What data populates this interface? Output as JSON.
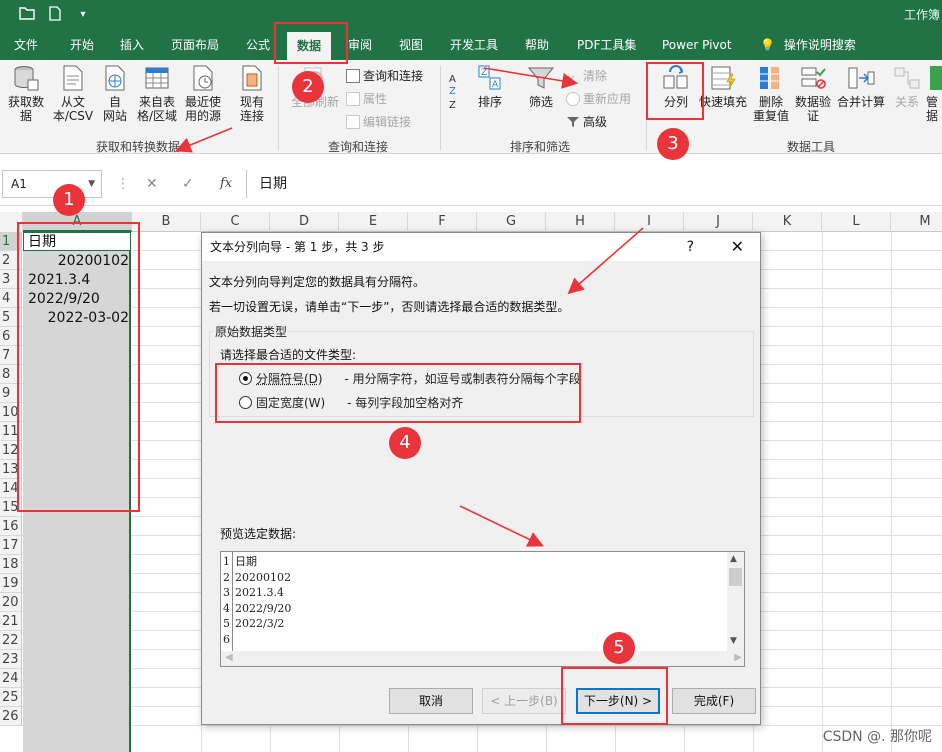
{
  "window": {
    "title_partial": "工作簿",
    "quick_access": [
      "folder-icon",
      "new-file-icon",
      "customize-icon"
    ]
  },
  "tabs": [
    "文件",
    "开始",
    "插入",
    "页面布局",
    "公式",
    "数据",
    "审阅",
    "视图",
    "开发工具",
    "帮助",
    "PDF工具集",
    "Power Pivot",
    "操作说明搜索"
  ],
  "active_tab": "数据",
  "ribbon": {
    "get_transform": {
      "buttons": [
        {
          "label": "获取数\n据",
          "icon": "database-icon"
        },
        {
          "label": "从文\n本/CSV",
          "icon": "text-file-icon"
        },
        {
          "label": "自\n网站",
          "icon": "web-icon"
        },
        {
          "label": "来自表\n格/区域",
          "icon": "table-icon"
        },
        {
          "label": "最近使\n用的源",
          "icon": "recent-icon"
        },
        {
          "label": "现有\n连接",
          "icon": "connection-icon"
        }
      ],
      "group_label": "获取和转换数据"
    },
    "queries": {
      "refresh_label": "全部刷新",
      "items": [
        "查询和连接",
        "属性",
        "编辑链接"
      ],
      "group_label": "查询和连接"
    },
    "sort_filter": {
      "sort_label": "排序",
      "filter_label": "筛选",
      "items": [
        "清除",
        "重新应用",
        "高级"
      ],
      "group_label": "排序和筛选"
    },
    "data_tools": {
      "buttons": [
        "分列",
        "快速填充",
        "删除\n重复值",
        "数据验\n证",
        "合并计算",
        "关系",
        "管\n据"
      ],
      "group_label": "数据工具"
    }
  },
  "formula_bar": {
    "name_box": "A1",
    "cancel_symbol": "✕",
    "enter_symbol": "✓",
    "fx_symbol": "fx",
    "value": "日期"
  },
  "grid": {
    "columns": [
      "A",
      "B",
      "C",
      "D",
      "E",
      "F",
      "G",
      "H",
      "I",
      "J",
      "K",
      "L",
      "M"
    ],
    "rows": [
      "1",
      "2",
      "3",
      "4",
      "5",
      "6",
      "7",
      "8",
      "9",
      "10",
      "11",
      "12",
      "13",
      "14",
      "15",
      "16",
      "17",
      "18",
      "19",
      "20",
      "21",
      "22",
      "23",
      "24",
      "25",
      "26"
    ],
    "cells": [
      {
        "value": "日期",
        "align": "left"
      },
      {
        "value": "20200102",
        "align": "right"
      },
      {
        "value": "2021.3.4",
        "align": "left"
      },
      {
        "value": "2022/9/20",
        "align": "left"
      },
      {
        "value": "2022-03-02",
        "align": "right"
      }
    ]
  },
  "dialog": {
    "title": "文本分列向导 - 第 1 步，共 3 步",
    "help": "?",
    "close": "✕",
    "line1": "文本分列向导判定您的数据具有分隔符。",
    "line2": "若一切设置无误，请单击“下一步”，否则请选择最合适的数据类型。",
    "group_title": "原始数据类型",
    "prompt": "请选择最合适的文件类型:",
    "options": [
      {
        "label": "分隔符号(D)",
        "desc": "- 用分隔字符，如逗号或制表符分隔每个字段",
        "selected": true
      },
      {
        "label": "固定宽度(W)",
        "desc": "- 每列字段加空格对齐",
        "selected": false
      }
    ],
    "preview_label": "预览选定数据:",
    "preview_rows": [
      "日期",
      "20200102",
      "2021.3.4",
      "2022/9/20",
      "2022/3/2",
      ""
    ],
    "preview_nums": [
      "1",
      "2",
      "3",
      "4",
      "5",
      "6"
    ],
    "buttons": {
      "cancel": "取消",
      "back": "< 上一步(B)",
      "next": "下一步(N) >",
      "finish": "完成(F)"
    }
  },
  "annotations": {
    "badges": [
      "1",
      "2",
      "3",
      "4",
      "5"
    ],
    "color": "#e8343a"
  },
  "watermark": "CSDN @. 那你呢"
}
